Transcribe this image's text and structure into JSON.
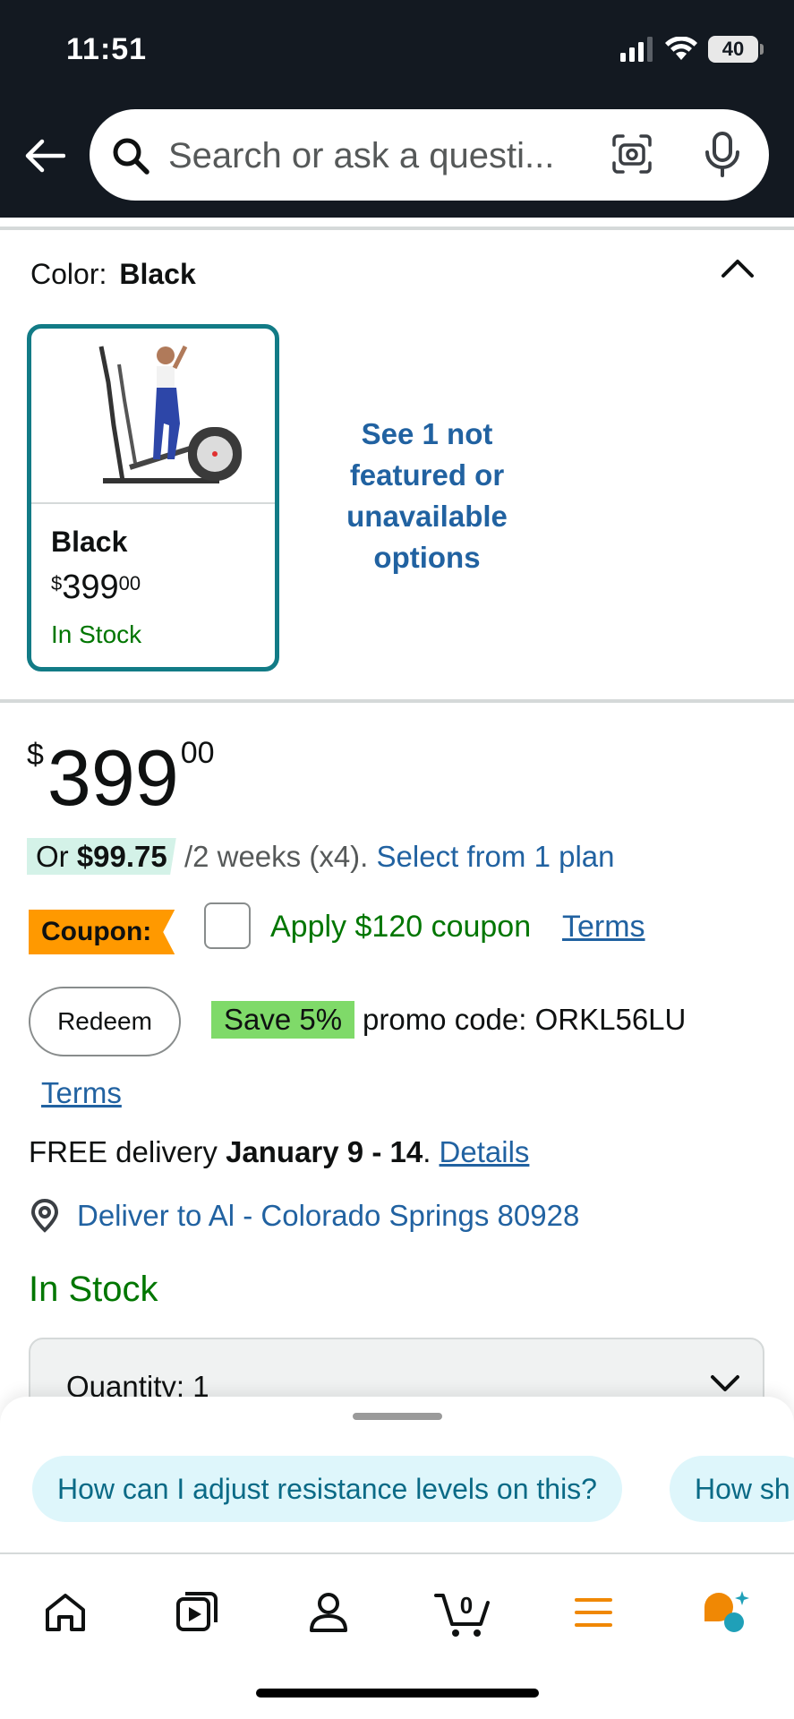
{
  "status_bar": {
    "time": "11:51",
    "battery": "40"
  },
  "search": {
    "placeholder": "Search or ask a questi..."
  },
  "color_selector": {
    "label": "Color:",
    "value": "Black",
    "option": {
      "name": "Black",
      "price_currency": "$",
      "price_whole": "399",
      "price_fraction": "00",
      "availability": "In Stock"
    },
    "see_more": "See 1 not featured or unavailable options"
  },
  "price": {
    "currency": "$",
    "whole": "399",
    "fraction": "00"
  },
  "installment": {
    "prefix": "Or ",
    "amount": "$99.75",
    "period": "/2 weeks (x4). ",
    "plan_link": "Select from 1 plan"
  },
  "coupon": {
    "tag": "Coupon:",
    "text": "Apply $120 coupon",
    "terms": "Terms"
  },
  "promo": {
    "redeem": "Redeem",
    "save": "Save 5%",
    "text": "promo code: ORKL56LU",
    "terms": "Terms"
  },
  "delivery": {
    "prefix": "FREE delivery ",
    "dates": "January 9 - 14",
    "suffix": ". ",
    "details": "Details"
  },
  "deliver_to": "Deliver to Al - Colorado Springs 80928",
  "stock": "In Stock",
  "quantity": {
    "label": "Quantity:  1"
  },
  "suggestions": [
    "How can I adjust resistance levels on this?",
    "How sh"
  ],
  "nav": {
    "cart_count": "0"
  },
  "colors": {
    "header": "#131921",
    "link": "#2162a1",
    "in_stock": "#007600",
    "coupon": "#ff9900",
    "selected_border": "#127b86"
  }
}
